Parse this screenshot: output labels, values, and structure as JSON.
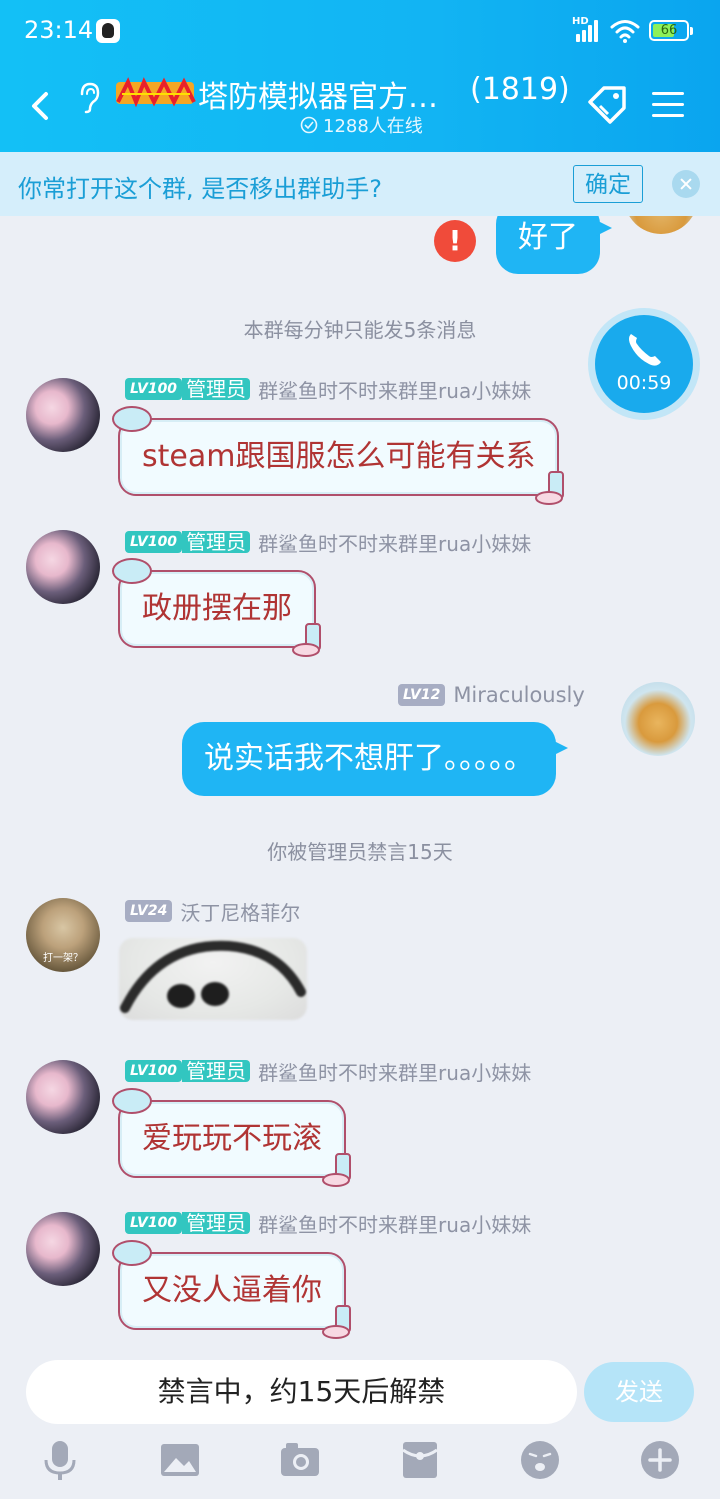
{
  "status_bar": {
    "time": "23:14",
    "battery": "66",
    "network": "HD"
  },
  "header": {
    "title": "塔防模拟器官方…",
    "member_count": "(1819)",
    "online": "1288人在线"
  },
  "banner": {
    "text": "你常打开这个群, 是否移出群助手?",
    "confirm_label": "确定"
  },
  "call": {
    "timer": "00:59"
  },
  "messages": [
    {
      "type": "self",
      "text": "好了",
      "failed": true
    },
    {
      "type": "system",
      "text": "本群每分钟只能发5条消息"
    },
    {
      "type": "other",
      "level": "LV100",
      "role": "管理员",
      "name": "群鲨鱼时不时来群里rua小妹妹",
      "text": "steam跟国服怎么可能有关系"
    },
    {
      "type": "other",
      "level": "LV100",
      "role": "管理员",
      "name": "群鲨鱼时不时来群里rua小妹妹",
      "text": "政册摆在那"
    },
    {
      "type": "self",
      "level": "LV12",
      "name": "Miraculously",
      "text": "说实话我不想肝了。。。。。"
    },
    {
      "type": "system",
      "text": "你被管理员禁言15天"
    },
    {
      "type": "other",
      "level": "LV24",
      "name": "沃丁尼格菲尔",
      "sticker": true,
      "avatar_caption": "打一架？"
    },
    {
      "type": "other",
      "level": "LV100",
      "role": "管理员",
      "name": "群鲨鱼时不时来群里rua小妹妹",
      "text": "爱玩玩不玩滚"
    },
    {
      "type": "other",
      "level": "LV100",
      "role": "管理员",
      "name": "群鲨鱼时不时来群里rua小妹妹",
      "text": "又没人逼着你"
    }
  ],
  "input": {
    "text": "禁言中，约15天后解禁",
    "send_label": "发送"
  },
  "toolbar": [
    "mic-icon",
    "image-icon",
    "camera-icon",
    "red-packet-icon",
    "emoji-icon",
    "plus-icon"
  ],
  "colors": {
    "header": "#12b4f3",
    "self_bubble": "#1fb5f4",
    "admin_badge": "#32c6c0",
    "banner_text": "#1a9ed6"
  }
}
